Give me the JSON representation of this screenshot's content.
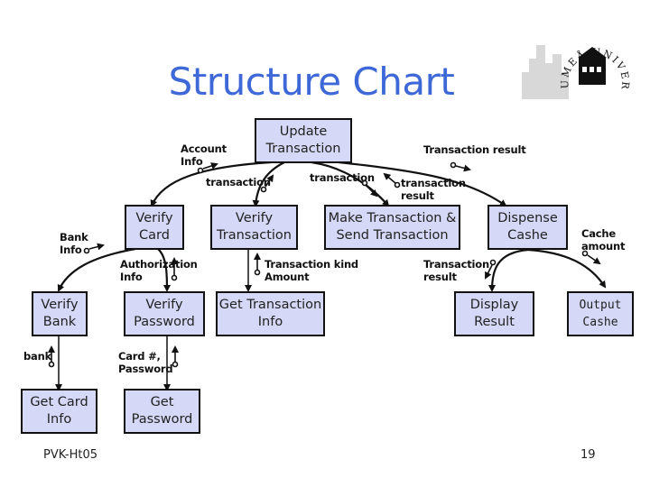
{
  "slide": {
    "title": "Structure Chart",
    "footer": "PVK-Ht05",
    "page_number": "19",
    "logo_text": "UMEÅ UNIVERSITET"
  },
  "colors": {
    "title": "#3e68d8",
    "module_fill": "#d6d8f8",
    "module_border": "#111111"
  },
  "modules": {
    "update_transaction": "Update\nTransaction",
    "verify_card": "Verify\nCard",
    "verify_transaction": "Verify\nTransaction",
    "make_send_transaction": "Make Transaction &\nSend Transaction",
    "dispense_cashe": "Dispense\nCashe",
    "verify_bank": "Verify\nBank",
    "verify_password": "Verify\nPassword",
    "get_transaction_info": "Get Transaction\nInfo",
    "display_result": "Display\nResult",
    "output_cashe": "Output\nCashe",
    "get_card_info": "Get Card\nInfo",
    "get_password": "Get\nPassword"
  },
  "couples": {
    "account_info": "Account\nInfo",
    "transaction_1": "transaction",
    "transaction_2": "transaction",
    "transaction_result_top": "Transaction result",
    "transaction_result_small": "transaction\nresult",
    "bank_info": "Bank\nInfo",
    "authorization_info": "Authorization\nInfo",
    "transaction_kind_amount": "Transaction kind\nAmount",
    "transaction_result_display": "Transaction\nresult",
    "cache_amount": "Cache\namount",
    "bank": "bank",
    "card_password": "Card #,\nPassword"
  }
}
